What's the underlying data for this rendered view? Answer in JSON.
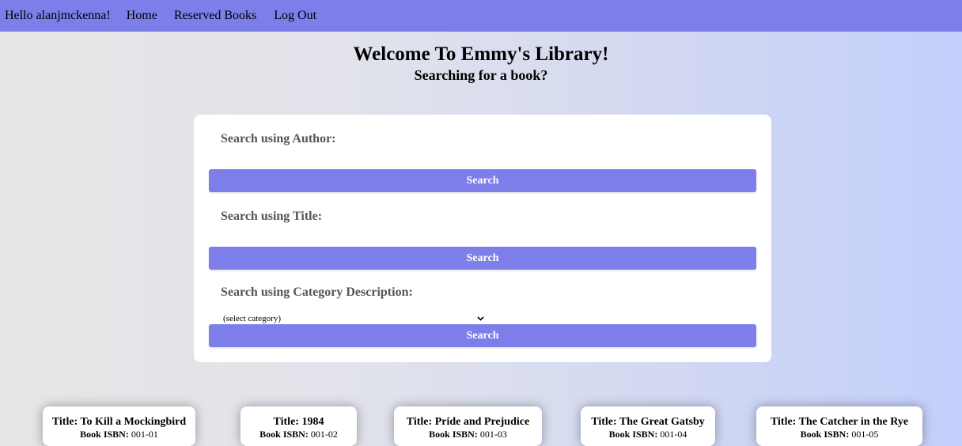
{
  "nav": {
    "greeting": "Hello alanjmckenna!",
    "home": "Home",
    "reserved": "Reserved Books",
    "logout": "Log Out"
  },
  "header": {
    "title": "Welcome To Emmy's Library!",
    "subtitle": "Searching for a book?"
  },
  "search": {
    "author_label": "Search using Author:",
    "author_value": "",
    "title_label": "Search using Title:",
    "title_value": "",
    "category_label": "Search using Category Description:",
    "category_selected": "(select category)",
    "button_label": "Search"
  },
  "books": [
    {
      "title_prefix": "Title: ",
      "title": "To Kill a Mockingbird",
      "isbn_prefix": "Book ISBN:",
      "isbn": " 001-01"
    },
    {
      "title_prefix": "Title: ",
      "title": "1984",
      "isbn_prefix": "Book ISBN:",
      "isbn": " 001-02"
    },
    {
      "title_prefix": "Title: ",
      "title": "Pride and Prejudice",
      "isbn_prefix": "Book ISBN:",
      "isbn": " 001-03"
    },
    {
      "title_prefix": "Title: ",
      "title": "The Great Gatsby",
      "isbn_prefix": "Book ISBN:",
      "isbn": " 001-04"
    },
    {
      "title_prefix": "Title: ",
      "title": "The Catcher in the Rye",
      "isbn_prefix": "Book ISBN:",
      "isbn": " 001-05"
    }
  ],
  "colors": {
    "accent": "#7d7eea",
    "panel": "#ffffff"
  }
}
